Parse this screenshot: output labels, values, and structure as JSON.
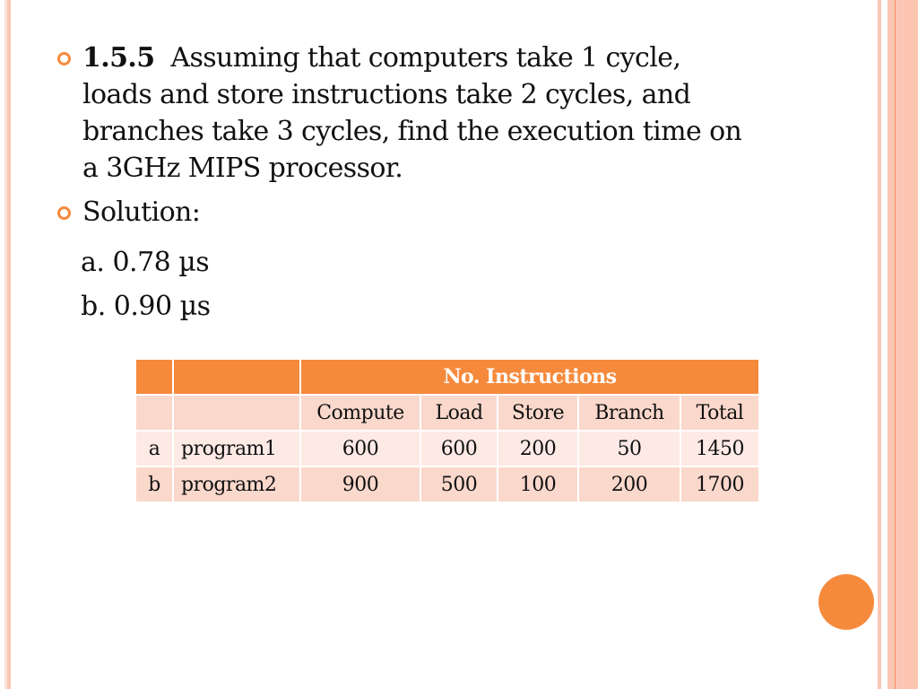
{
  "slide": {
    "bullets": [
      {
        "number": "1.5.5",
        "text": "Assuming that computers take 1 cycle, loads and store instructions take 2 cycles, and branches take 3 cycles, find the execution time on a 3GHz MIPS processor."
      },
      {
        "text": "Solution:"
      }
    ],
    "answers": [
      "a. 0.78 µs",
      "b. 0.90 µs"
    ],
    "lines": [
      "Assuming that computers take 1 cycle,",
      "loads and store instructions take 2 cycles, and",
      "branches take 3 cycles, find the execution time on",
      "a 3GHz MIPS processor."
    ]
  },
  "table": {
    "group_header": "No. Instructions",
    "columns": [
      "Compute",
      "Load",
      "Store",
      "Branch",
      "Total"
    ],
    "rows": [
      {
        "id": "a",
        "name": "program1",
        "values": [
          "600",
          "600",
          "200",
          "50",
          "1450"
        ]
      },
      {
        "id": "b",
        "name": "program2",
        "values": [
          "900",
          "500",
          "100",
          "200",
          "1700"
        ]
      }
    ]
  },
  "colors": {
    "accent": "#f68a3c",
    "stripe": "#fbc7b4",
    "row_light": "#fdeae5",
    "row_dark": "#fad8cc"
  }
}
